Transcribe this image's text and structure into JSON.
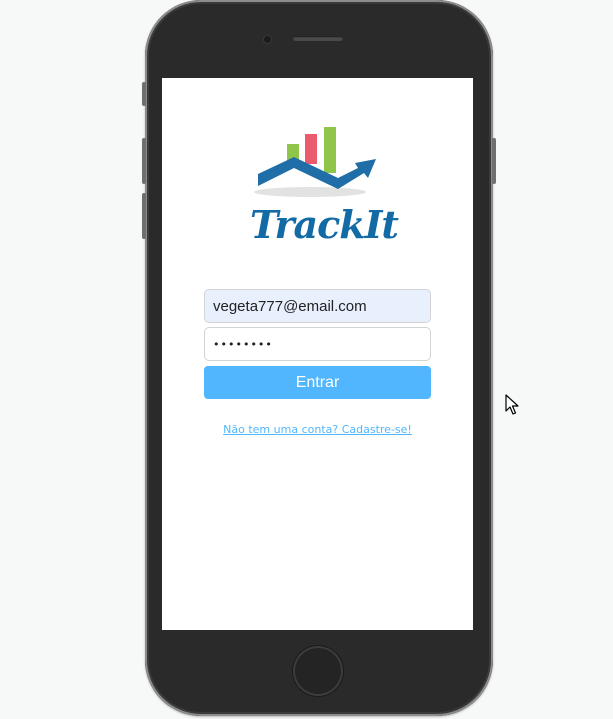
{
  "app": {
    "logo_text": "TrackIt",
    "logo_icon": "bar-chart-trend-arrow-icon",
    "accent_color": "#52b6fe",
    "brand_color": "#126ba5"
  },
  "login": {
    "email_value": "vegeta777@email.com",
    "password_value": "12345678",
    "submit_label": "Entrar",
    "signup_link": "Não tem uma conta? Cadastre-se!"
  },
  "cursor": {
    "icon": "mouse-pointer-icon"
  }
}
